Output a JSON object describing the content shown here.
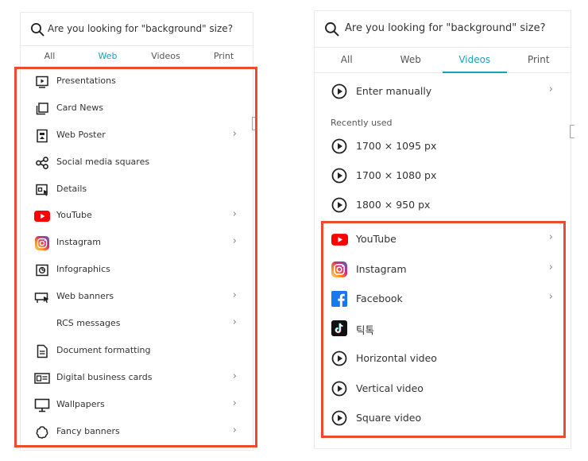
{
  "left": {
    "search_placeholder": "Are you looking for \"background\" size?",
    "tabs": [
      "All",
      "Web",
      "Videos",
      "Print"
    ],
    "active_tab": "Web",
    "items": [
      {
        "label": "Presentations",
        "icon": "presentation-icon",
        "chevron": false
      },
      {
        "label": "Card News",
        "icon": "card-news-icon",
        "chevron": false
      },
      {
        "label": "Web Poster",
        "icon": "web-poster-icon",
        "chevron": true
      },
      {
        "label": "Social media squares",
        "icon": "share-icon",
        "chevron": false
      },
      {
        "label": "Details",
        "icon": "details-icon",
        "chevron": false
      },
      {
        "label": "YouTube",
        "icon": "youtube-icon",
        "chevron": true
      },
      {
        "label": "Instagram",
        "icon": "instagram-icon",
        "chevron": true
      },
      {
        "label": "Infographics",
        "icon": "infographics-icon",
        "chevron": false
      },
      {
        "label": "Web banners",
        "icon": "web-banner-icon",
        "chevron": true
      },
      {
        "label": "RCS messages",
        "icon": "",
        "chevron": true
      },
      {
        "label": "Document formatting",
        "icon": "document-icon",
        "chevron": false
      },
      {
        "label": "Digital business cards",
        "icon": "business-card-icon",
        "chevron": true
      },
      {
        "label": "Wallpapers",
        "icon": "monitor-icon",
        "chevron": true
      },
      {
        "label": "Fancy banners",
        "icon": "fancy-banner-icon",
        "chevron": true
      }
    ]
  },
  "right": {
    "search_placeholder": "Are you looking for \"background\" size?",
    "tabs": [
      "All",
      "Web",
      "Videos",
      "Print"
    ],
    "active_tab": "Videos",
    "enter_manually": "Enter manually",
    "recently_used_label": "Recently used",
    "recent": [
      "1700 × 1095 px",
      "1700 × 1080 px",
      "1800 × 950 px"
    ],
    "platforms": [
      {
        "label": "YouTube",
        "icon": "youtube-icon",
        "chevron": true
      },
      {
        "label": "Instagram",
        "icon": "instagram-icon",
        "chevron": true
      },
      {
        "label": "Facebook",
        "icon": "facebook-icon",
        "chevron": true
      },
      {
        "label": "틱톡",
        "icon": "tiktok-icon",
        "chevron": false
      },
      {
        "label": "Horizontal video",
        "icon": "play-circle-icon",
        "chevron": false
      },
      {
        "label": "Vertical video",
        "icon": "play-circle-icon",
        "chevron": false
      },
      {
        "label": "Square video",
        "icon": "play-circle-icon",
        "chevron": false
      }
    ]
  },
  "colors": {
    "accent": "#1aa3b8",
    "highlight": "#ee4a2e",
    "youtube": "#ff0000",
    "facebook": "#1877f2"
  }
}
